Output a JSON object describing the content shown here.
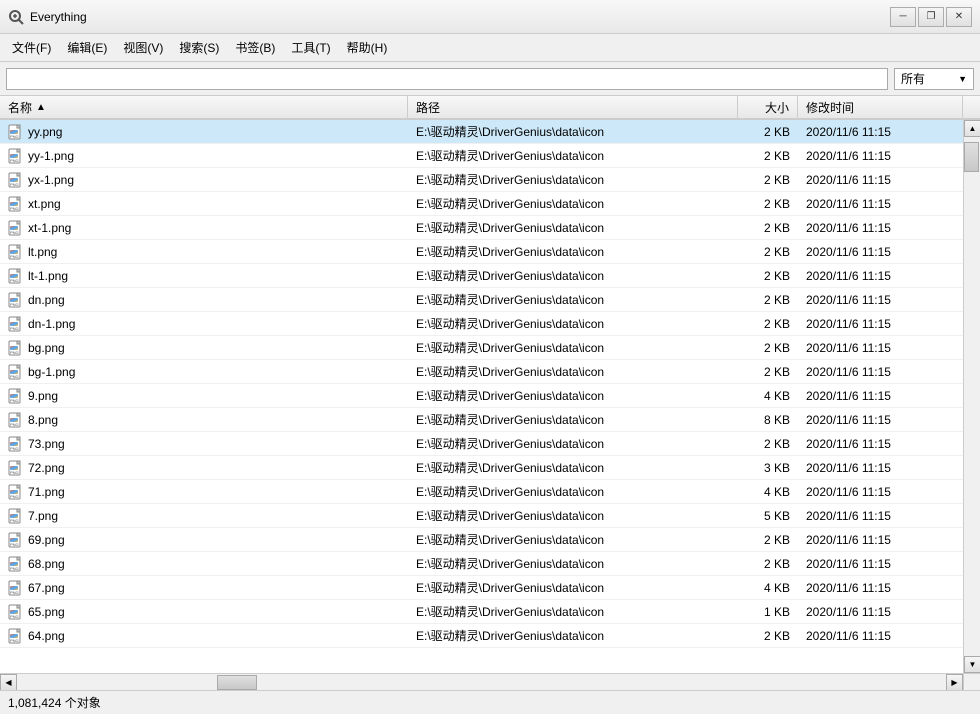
{
  "titleBar": {
    "title": "Everything",
    "icon": "🔍"
  },
  "menuBar": {
    "items": [
      {
        "label": "文件(F)"
      },
      {
        "label": "编辑(E)"
      },
      {
        "label": "视图(V)"
      },
      {
        "label": "搜索(S)"
      },
      {
        "label": "书签(B)"
      },
      {
        "label": "工具(T)"
      },
      {
        "label": "帮助(H)"
      }
    ]
  },
  "searchBar": {
    "placeholder": "",
    "dropdownValue": "所有"
  },
  "columns": {
    "name": "名称",
    "path": "路径",
    "size": "大小",
    "modified": "修改时间"
  },
  "files": [
    {
      "name": "yy.png",
      "path": "E:\\驱动精灵\\DriverGenius\\data\\icon",
      "size": "2 KB",
      "modified": "2020/11/6 11:15"
    },
    {
      "name": "yy-1.png",
      "path": "E:\\驱动精灵\\DriverGenius\\data\\icon",
      "size": "2 KB",
      "modified": "2020/11/6 11:15"
    },
    {
      "name": "yx-1.png",
      "path": "E:\\驱动精灵\\DriverGenius\\data\\icon",
      "size": "2 KB",
      "modified": "2020/11/6 11:15"
    },
    {
      "name": "xt.png",
      "path": "E:\\驱动精灵\\DriverGenius\\data\\icon",
      "size": "2 KB",
      "modified": "2020/11/6 11:15"
    },
    {
      "name": "xt-1.png",
      "path": "E:\\驱动精灵\\DriverGenius\\data\\icon",
      "size": "2 KB",
      "modified": "2020/11/6 11:15"
    },
    {
      "name": "lt.png",
      "path": "E:\\驱动精灵\\DriverGenius\\data\\icon",
      "size": "2 KB",
      "modified": "2020/11/6 11:15"
    },
    {
      "name": "lt-1.png",
      "path": "E:\\驱动精灵\\DriverGenius\\data\\icon",
      "size": "2 KB",
      "modified": "2020/11/6 11:15"
    },
    {
      "name": "dn.png",
      "path": "E:\\驱动精灵\\DriverGenius\\data\\icon",
      "size": "2 KB",
      "modified": "2020/11/6 11:15"
    },
    {
      "name": "dn-1.png",
      "path": "E:\\驱动精灵\\DriverGenius\\data\\icon",
      "size": "2 KB",
      "modified": "2020/11/6 11:15"
    },
    {
      "name": "bg.png",
      "path": "E:\\驱动精灵\\DriverGenius\\data\\icon",
      "size": "2 KB",
      "modified": "2020/11/6 11:15"
    },
    {
      "name": "bg-1.png",
      "path": "E:\\驱动精灵\\DriverGenius\\data\\icon",
      "size": "2 KB",
      "modified": "2020/11/6 11:15"
    },
    {
      "name": "9.png",
      "path": "E:\\驱动精灵\\DriverGenius\\data\\icon",
      "size": "4 KB",
      "modified": "2020/11/6 11:15"
    },
    {
      "name": "8.png",
      "path": "E:\\驱动精灵\\DriverGenius\\data\\icon",
      "size": "8 KB",
      "modified": "2020/11/6 11:15"
    },
    {
      "name": "73.png",
      "path": "E:\\驱动精灵\\DriverGenius\\data\\icon",
      "size": "2 KB",
      "modified": "2020/11/6 11:15"
    },
    {
      "name": "72.png",
      "path": "E:\\驱动精灵\\DriverGenius\\data\\icon",
      "size": "3 KB",
      "modified": "2020/11/6 11:15"
    },
    {
      "name": "71.png",
      "path": "E:\\驱动精灵\\DriverGenius\\data\\icon",
      "size": "4 KB",
      "modified": "2020/11/6 11:15"
    },
    {
      "name": "7.png",
      "path": "E:\\驱动精灵\\DriverGenius\\data\\icon",
      "size": "5 KB",
      "modified": "2020/11/6 11:15"
    },
    {
      "name": "69.png",
      "path": "E:\\驱动精灵\\DriverGenius\\data\\icon",
      "size": "2 KB",
      "modified": "2020/11/6 11:15"
    },
    {
      "name": "68.png",
      "path": "E:\\驱动精灵\\DriverGenius\\data\\icon",
      "size": "2 KB",
      "modified": "2020/11/6 11:15"
    },
    {
      "name": "67.png",
      "path": "E:\\驱动精灵\\DriverGenius\\data\\icon",
      "size": "4 KB",
      "modified": "2020/11/6 11:15"
    },
    {
      "name": "65.png",
      "path": "E:\\驱动精灵\\DriverGenius\\data\\icon",
      "size": "1 KB",
      "modified": "2020/11/6 11:15"
    },
    {
      "name": "64.png",
      "path": "E:\\驱动精灵\\DriverGenius\\data\\icon",
      "size": "2 KB",
      "modified": "2020/11/6 11:15"
    }
  ],
  "statusBar": {
    "text": "1,081,424 个对象"
  },
  "windowControls": {
    "minimize": "─",
    "restore": "❐",
    "close": "✕"
  }
}
